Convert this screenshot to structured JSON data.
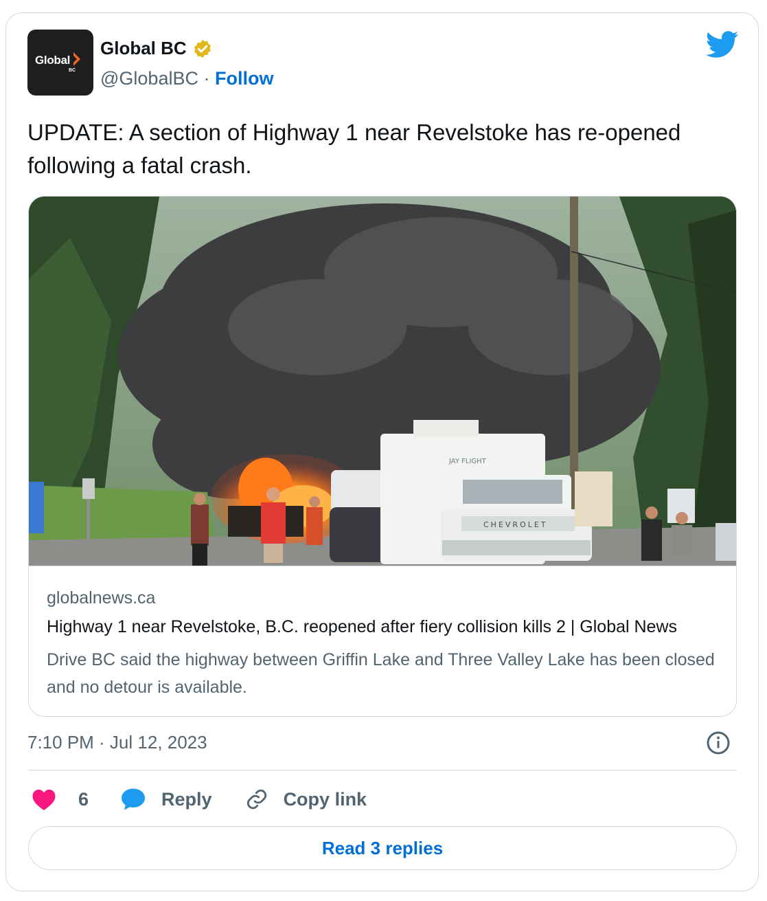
{
  "account": {
    "name": "Global BC",
    "handle": "@GlobalBC",
    "separator": " · ",
    "follow_label": "Follow",
    "avatar_brand": "Global",
    "avatar_sub": "BC"
  },
  "tweet": {
    "text": "UPDATE: A section of Highway 1 near Revelstoke has re-opened following a fatal crash.",
    "timestamp": "7:10 PM · Jul 12, 2023"
  },
  "link_card": {
    "domain": "globalnews.ca",
    "title": "Highway 1 near Revelstoke, B.C. reopened after fiery collision kills 2 | Global News",
    "description": "Drive BC said the highway between Griffin Lake and Three Valley Lake has been closed and no detour is available."
  },
  "photo": {
    "truck_brand": "CHEVROLET",
    "trailer_brand": "JAY FLIGHT"
  },
  "actions": {
    "like_count": "6",
    "reply_label": "Reply",
    "copy_label": "Copy link"
  },
  "read_replies_label": "Read 3 replies",
  "colors": {
    "twitter_blue": "#1d9bf0",
    "link_blue": "#006fd6",
    "like_pink": "#f91880",
    "verified_gold": "#e2b719",
    "secondary_text": "#536471",
    "border": "#cfd9de",
    "brand_orange": "#f26522"
  },
  "icons": [
    "verified-badge-icon",
    "twitter-bird-icon",
    "info-icon",
    "heart-icon",
    "reply-bubble-icon",
    "link-icon"
  ]
}
